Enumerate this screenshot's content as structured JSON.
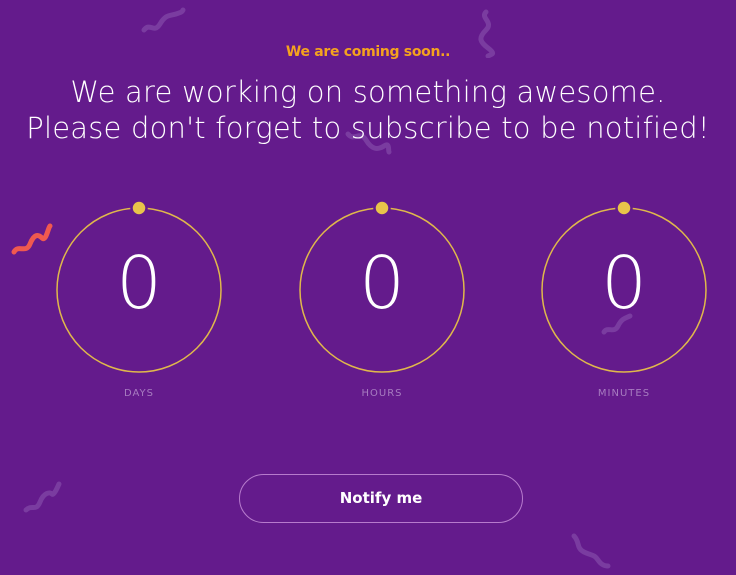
{
  "hero": {
    "pre_title": "We are coming soon..",
    "headline_line1": "We are working on something awesome.",
    "headline_line2": "Please don't forget to subscribe to be notified!"
  },
  "countdown": {
    "days": {
      "value": "0",
      "label": "DAYS"
    },
    "hours": {
      "value": "0",
      "label": "HOURS"
    },
    "minutes": {
      "value": "0",
      "label": "MINUTES"
    }
  },
  "actions": {
    "notify_label": "Notify me"
  },
  "colors": {
    "background": "#641b8c",
    "accent_orange": "#f4a21f",
    "ring_gold": "#e0b84b",
    "dot_gold": "#e8c44a",
    "label_muted": "#a77cc0",
    "button_border": "#b77bcd",
    "squiggle_red": "#f0594f",
    "squiggle_faint": "#7a3ca0"
  }
}
